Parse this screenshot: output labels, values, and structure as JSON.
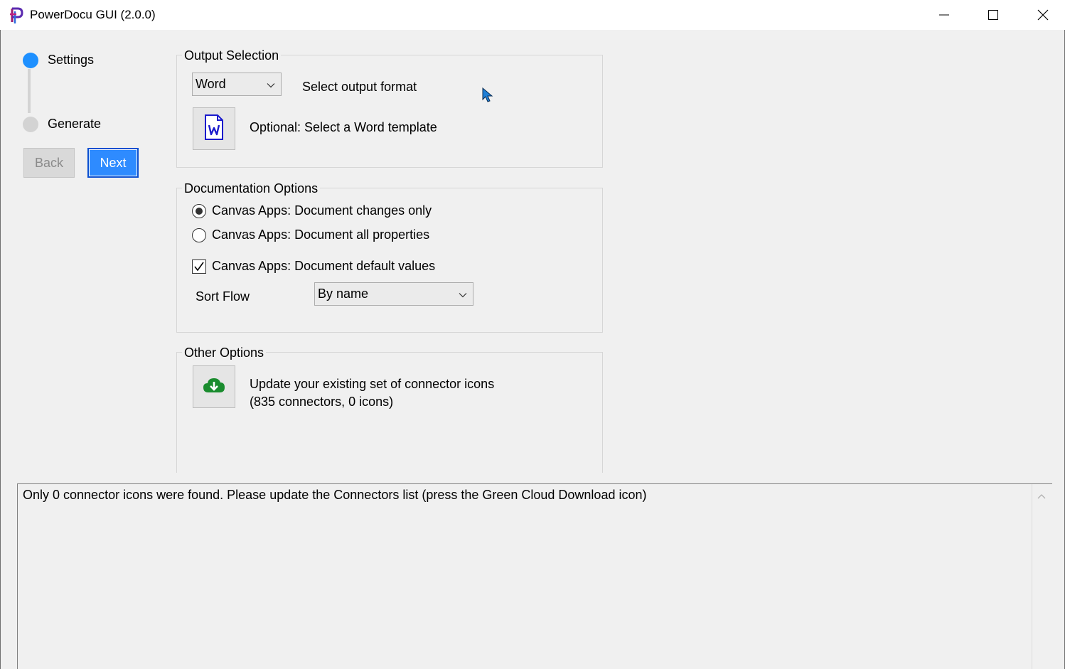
{
  "window": {
    "title": "PowerDocu GUI (2.0.0)",
    "app_icon": "powerdocu-logo-icon",
    "controls": [
      "minimize-icon",
      "maximize-icon",
      "close-icon"
    ]
  },
  "stepper": {
    "steps": [
      {
        "label": "Settings",
        "active": true,
        "color": "#1e90ff"
      },
      {
        "label": "Generate",
        "active": false,
        "color": "#d3d3d3"
      }
    ]
  },
  "nav": {
    "back_label": "Back",
    "next_label": "Next"
  },
  "output_selection": {
    "title": "Output Selection",
    "format_value": "Word",
    "format_label": "Select output format",
    "template_icon": "word-document-icon",
    "template_label": "Optional: Select a Word template"
  },
  "documentation_options": {
    "title": "Documentation Options",
    "radio_changes_only": "Canvas Apps: Document changes only",
    "radio_all_properties": "Canvas Apps: Document all properties",
    "checkbox_default_values": "Canvas Apps: Document default values",
    "selected_radio": "changes_only",
    "default_values_checked": true,
    "sort_flow_label": "Sort Flow",
    "sort_flow_value": "By name"
  },
  "other_options": {
    "title": "Other Options",
    "update_icon": "cloud-download-icon",
    "update_line1": "Update your existing set of connector icons",
    "update_line2": "(835 connectors, 0 icons)"
  },
  "log": {
    "message": "Only 0 connector icons were found. Please update the Connectors list (press the Green Cloud Download icon)"
  },
  "colors": {
    "accent": "#1e90ff",
    "next_button": "#2e8bff",
    "cloud_icon": "#1a8c2e",
    "word_icon": "#1a1acc"
  }
}
